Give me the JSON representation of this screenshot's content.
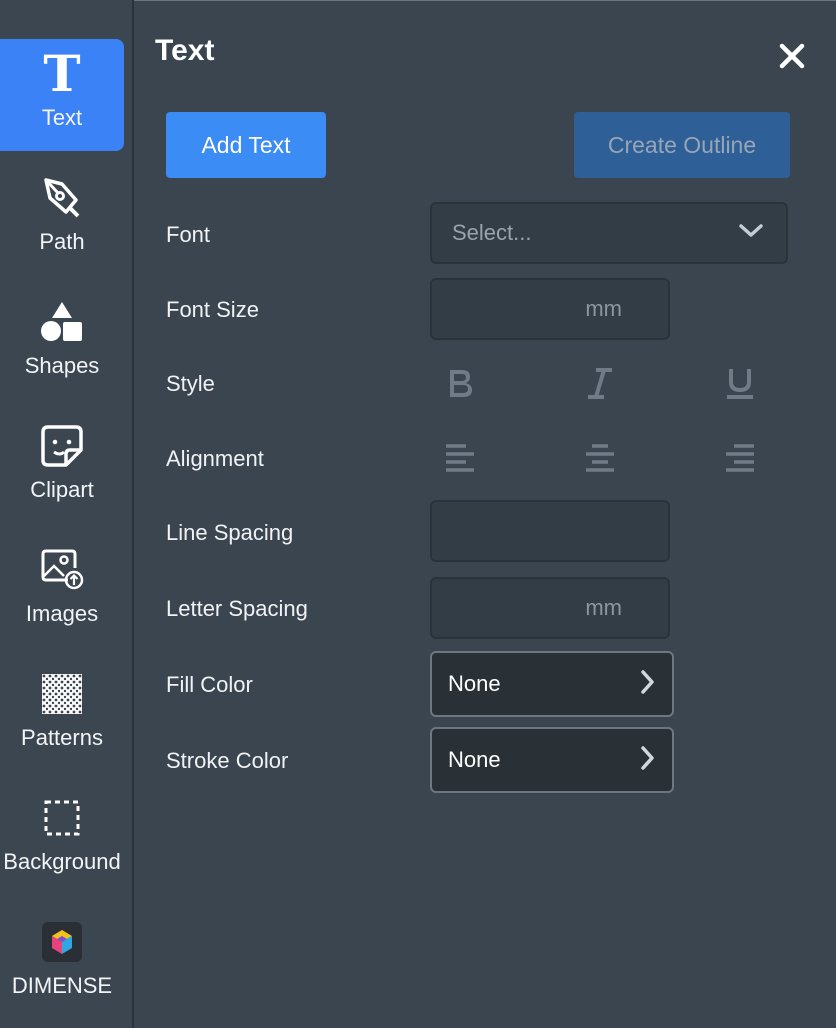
{
  "sidebar": {
    "items": [
      {
        "label": "Text",
        "icon": "text-t-icon",
        "active": true
      },
      {
        "label": "Path",
        "icon": "pen-tool-icon"
      },
      {
        "label": "Shapes",
        "icon": "shapes-icon"
      },
      {
        "label": "Clipart",
        "icon": "sticker-icon"
      },
      {
        "label": "Images",
        "icon": "image-upload-icon"
      },
      {
        "label": "Patterns",
        "icon": "pattern-grid-icon"
      },
      {
        "label": "Background",
        "icon": "dashed-square-icon"
      },
      {
        "label": "DIMENSE",
        "icon": "dimense-logo-icon"
      }
    ]
  },
  "panel": {
    "title": "Text",
    "add_text_label": "Add Text",
    "create_outline_label": "Create Outline",
    "font_label": "Font",
    "font_placeholder": "Select...",
    "font_size_label": "Font Size",
    "font_size_unit": "mm",
    "style_label": "Style",
    "alignment_label": "Alignment",
    "line_spacing_label": "Line Spacing",
    "letter_spacing_label": "Letter Spacing",
    "letter_spacing_unit": "mm",
    "fill_color_label": "Fill Color",
    "fill_color_value": "None",
    "stroke_color_label": "Stroke Color",
    "stroke_color_value": "None"
  },
  "colors": {
    "accent": "#3b8cf5",
    "panel_bg": "#3a4550",
    "disabled_button": "#2e5f96"
  }
}
